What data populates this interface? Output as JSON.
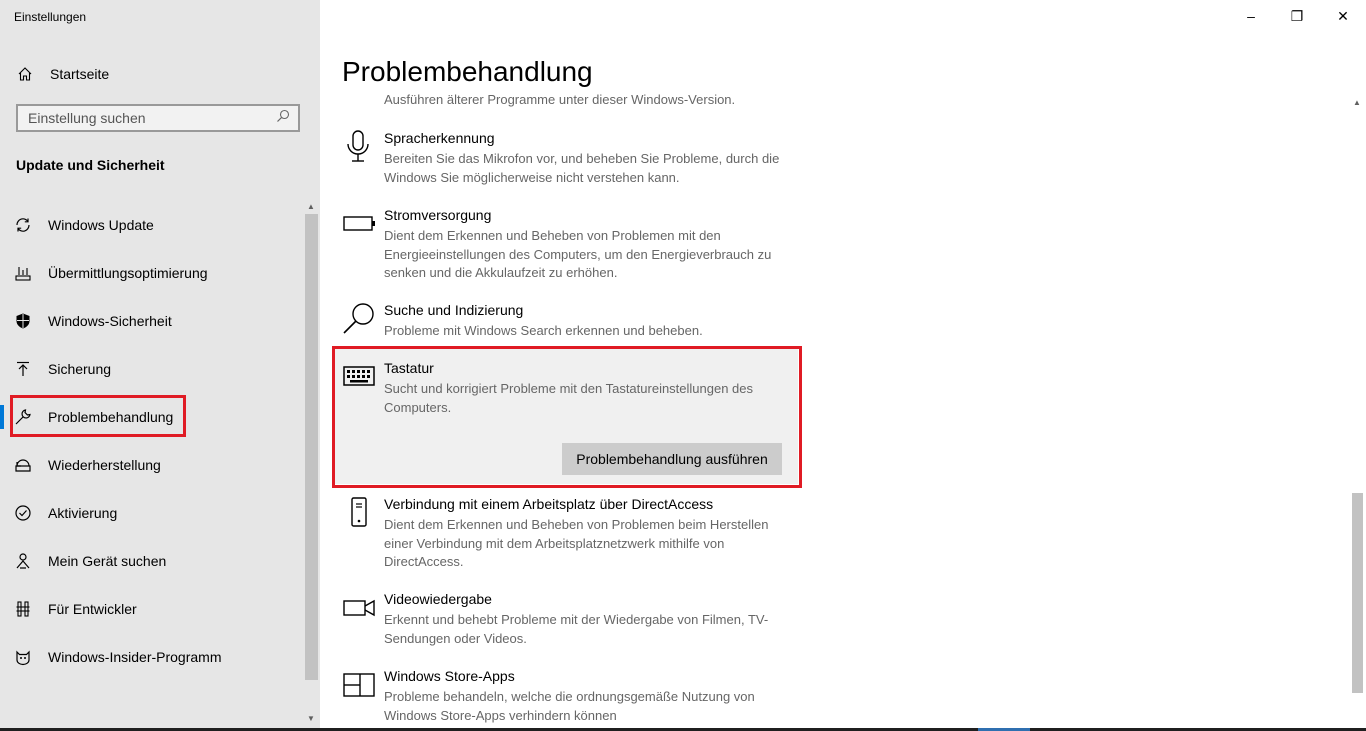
{
  "window": {
    "app_title": "Einstellungen",
    "controls": {
      "minimize": "–",
      "maximize": "❐",
      "close": "✕"
    }
  },
  "sidebar": {
    "home_label": "Startseite",
    "search_placeholder": "Einstellung suchen",
    "section_title": "Update und Sicherheit",
    "items": [
      {
        "label": "Windows Update",
        "icon": "sync-icon"
      },
      {
        "label": "Übermittlungsoptimierung",
        "icon": "delivery-optimization-icon"
      },
      {
        "label": "Windows-Sicherheit",
        "icon": "shield-icon"
      },
      {
        "label": "Sicherung",
        "icon": "backup-arrow-icon"
      },
      {
        "label": "Problembehandlung",
        "icon": "wrench-icon",
        "active": true
      },
      {
        "label": "Wiederherstellung",
        "icon": "recovery-icon"
      },
      {
        "label": "Aktivierung",
        "icon": "check-circle-icon"
      },
      {
        "label": "Mein Gerät suchen",
        "icon": "find-device-icon"
      },
      {
        "label": "Für Entwickler",
        "icon": "developer-tools-icon"
      },
      {
        "label": "Windows-Insider-Programm",
        "icon": "insider-cat-icon"
      }
    ]
  },
  "main": {
    "title": "Problembehandlung",
    "partial_top_text": "Ausführen älterer Programme unter dieser Windows-Version.",
    "troubleshooters": [
      {
        "title": "Spracherkennung",
        "icon": "microphone-icon",
        "description": "Bereiten Sie das Mikrofon vor, und beheben Sie Probleme, durch die Windows Sie möglicherweise nicht verstehen kann."
      },
      {
        "title": "Stromversorgung",
        "icon": "battery-icon",
        "description": "Dient dem Erkennen und Beheben von Problemen mit den Energieeinstellungen des Computers, um den Energieverbrauch zu senken und die Akkulaufzeit zu erhöhen."
      },
      {
        "title": "Suche und Indizierung",
        "icon": "search-icon",
        "description": "Probleme mit Windows Search erkennen und beheben."
      },
      {
        "title": "Tastatur",
        "icon": "keyboard-icon",
        "selected": true,
        "description": "Sucht und korrigiert Probleme mit den Tastatureinstellungen des Computers."
      },
      {
        "title": "Verbindung mit einem Arbeitsplatz über DirectAccess",
        "icon": "phone-device-icon",
        "description": "Dient dem Erkennen und Beheben von Problemen beim Herstellen einer Verbindung mit dem Arbeitsplatznetzwerk mithilfe von DirectAccess."
      },
      {
        "title": "Videowiedergabe",
        "icon": "video-camera-icon",
        "description": "Erkennt und behebt Probleme mit der Wiedergabe von Filmen, TV-Sendungen oder Videos."
      },
      {
        "title": "Windows Store-Apps",
        "icon": "store-apps-icon",
        "description": "Probleme behandeln, welche die ordnungsgemäße Nutzung von Windows Store-Apps verhindern können"
      }
    ],
    "run_button_label": "Problembehandlung ausführen"
  },
  "colors": {
    "accent": "#0078d7",
    "highlight_box": "#e01b24",
    "sidebar_bg": "#e6e6e6"
  }
}
